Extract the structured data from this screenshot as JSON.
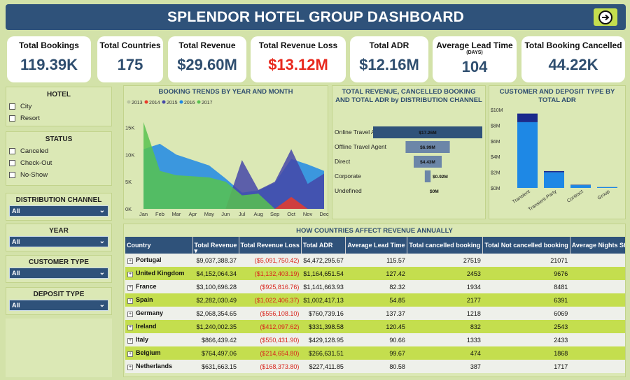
{
  "header": {
    "title": "SPLENDOR HOTEL GROUP DASHBOARD"
  },
  "kpis": [
    {
      "label": "Total Bookings",
      "value": "119.39K"
    },
    {
      "label": "Total Countries",
      "value": "175"
    },
    {
      "label": "Total Revenue",
      "value": "$29.60M"
    },
    {
      "label": "Total Revenue Loss",
      "value": "$13.12M",
      "color": "#e8291e"
    },
    {
      "label": "Total ADR",
      "value": "$12.16M"
    },
    {
      "label": "Average Lead Time",
      "sublabel": "(DAYS)",
      "value": "104"
    },
    {
      "label": "Total Booking Cancelled",
      "value": "44.22K"
    }
  ],
  "slicers": {
    "hotel": {
      "title": "HOTEL",
      "options": [
        "City",
        "Resort"
      ]
    },
    "status": {
      "title": "STATUS",
      "options": [
        "Canceled",
        "Check-Out",
        "No-Show"
      ]
    },
    "distribution": {
      "title": "DISTRIBUTION CHANNEL",
      "value": "All"
    },
    "year": {
      "title": "YEAR",
      "value": "All"
    },
    "customer": {
      "title": "CUSTOMER TYPE",
      "value": "All"
    },
    "deposit": {
      "title": "DEPOSIT TYPE",
      "value": "All"
    }
  },
  "colors": {
    "2013": "#b9c4a0",
    "2014": "#e83b2a",
    "2015": "#4547a8",
    "2016": "#1e88e5",
    "2017": "#58c24f"
  },
  "chart_data": [
    {
      "type": "area",
      "title": "BOOKING TRENDS BY YEAR AND MONTH",
      "legend": [
        "2013",
        "2014",
        "2015",
        "2016",
        "2017"
      ],
      "categories": [
        "Jan",
        "Feb",
        "Mar",
        "Apr",
        "May",
        "Jun",
        "Jul",
        "Aug",
        "Sep",
        "Oct",
        "Nov",
        "Dec"
      ],
      "yticks": [
        "15K",
        "10K",
        "5K",
        "0K"
      ],
      "ylim": [
        0,
        17000
      ]
    },
    {
      "type": "bar",
      "title": "TOTAL REVENUE, CANCELLED BOOKING AND TOTAL ADR by DISTRIBUTION CHANNEL",
      "categories": [
        "Online Travel Agent",
        "Offline Travel Agent",
        "Direct",
        "Corporate",
        "Undefined"
      ],
      "values": [
        17.26,
        6.99,
        4.43,
        0.92,
        0
      ],
      "labels": [
        "$17.26M",
        "$6.99M",
        "$4.43M",
        "$0.92M",
        "$0M"
      ]
    },
    {
      "type": "bar",
      "title": "CUSTOMER AND DEPOSIT TYPE BY TOTAL ADR",
      "categories": [
        "Transient",
        "Transient-Party",
        "Contract",
        "Group"
      ],
      "series": [
        {
          "values": [
            8.4,
            2.0,
            0.35,
            0.1
          ]
        },
        {
          "values": [
            1.1,
            0.15,
            0.05,
            0.01
          ]
        }
      ],
      "yticks": [
        "$10M",
        "$8M",
        "$6M",
        "$4M",
        "$2M",
        "$0M"
      ],
      "ylim": [
        0,
        10
      ]
    }
  ],
  "table": {
    "title": "HOW COUNTRIES AFFECT REVENUE ANNUALLY",
    "columns": [
      "Country",
      "Total Revenue",
      "Total Revenue Loss",
      "Total ADR",
      "Average Lead Time",
      "Total cancelled booking",
      "Total Not cancelled booking",
      "Average Nights Sta"
    ],
    "rows": [
      [
        "Portugal",
        "$9,037,388.37",
        "($5,091,750.42)",
        "$4,472,295.67",
        "115.57",
        "27519",
        "21071",
        ""
      ],
      [
        "United Kingdom",
        "$4,152,064.34",
        "($1,132,403.19)",
        "$1,164,651.54",
        "127.42",
        "2453",
        "9676",
        ""
      ],
      [
        "France",
        "$3,100,696.28",
        "($925,816.76)",
        "$1,141,663.93",
        "82.32",
        "1934",
        "8481",
        ""
      ],
      [
        "Spain",
        "$2,282,030.49",
        "($1,022,406.37)",
        "$1,002,417.13",
        "54.85",
        "2177",
        "6391",
        ""
      ],
      [
        "Germany",
        "$2,068,354.65",
        "($556,108.10)",
        "$760,739.16",
        "137.37",
        "1218",
        "6069",
        ""
      ],
      [
        "Ireland",
        "$1,240,002.35",
        "($412,097.62)",
        "$331,398.58",
        "120.45",
        "832",
        "2543",
        ""
      ],
      [
        "Italy",
        "$866,439.42",
        "($550,431.90)",
        "$429,128.95",
        "90.66",
        "1333",
        "2433",
        ""
      ],
      [
        "Belgium",
        "$764,497.06",
        "($214,654.80)",
        "$266,631.51",
        "99.67",
        "474",
        "1868",
        ""
      ],
      [
        "Netherlands",
        "$631,663.15",
        "($168,373.80)",
        "$227,411.85",
        "80.58",
        "387",
        "1717",
        ""
      ]
    ]
  }
}
